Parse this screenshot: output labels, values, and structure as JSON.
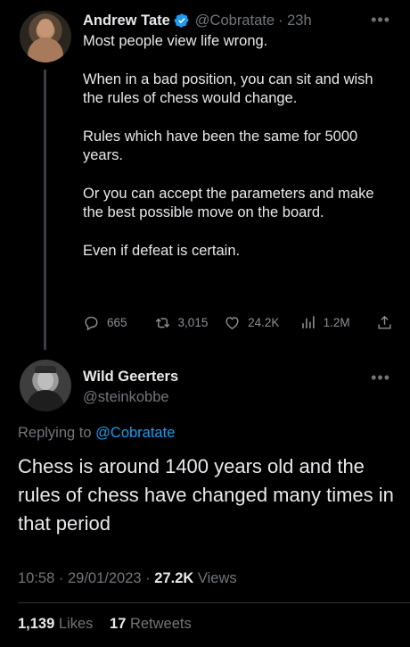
{
  "parent_tweet": {
    "author_name": "Andrew Tate",
    "handle": "@Cobratate",
    "time": "· 23h",
    "paragraphs": [
      "Most people view life wrong.",
      "When in a bad position, you can sit and wish the rules of chess would change.",
      "Rules which have been the same for 5000 years.",
      "Or you can accept the parameters and make the best possible move on the board.",
      "Even if defeat is certain."
    ],
    "replies": "665",
    "retweets": "3,015",
    "likes": "24.2K",
    "views": "1.2M",
    "more_icon": "•••"
  },
  "main_tweet": {
    "author_name": "Wild Geerters",
    "handle": "@steinkobbe",
    "more_icon": "•••",
    "replying_prefix": "Replying to",
    "replying_to": "@Cobratate",
    "text": "Chess is around 1400 years old and the rules of chess have changed many times in that period",
    "time": "10:58",
    "date": "29/01/2023",
    "views_count": "27.2K",
    "views_label": "Views",
    "likes_count": "1,139",
    "likes_label": "Likes",
    "retweets_count": "17",
    "retweets_label": "Retweets"
  },
  "colors": {
    "background": "#000000",
    "text": "#e7e9ea",
    "muted": "#71767b",
    "link": "#1d9bf0",
    "verified": "#1d9bf0"
  },
  "icons": [
    "verified-badge-icon",
    "reply-icon",
    "retweet-icon",
    "like-icon",
    "views-icon",
    "share-icon",
    "more-icon"
  ]
}
